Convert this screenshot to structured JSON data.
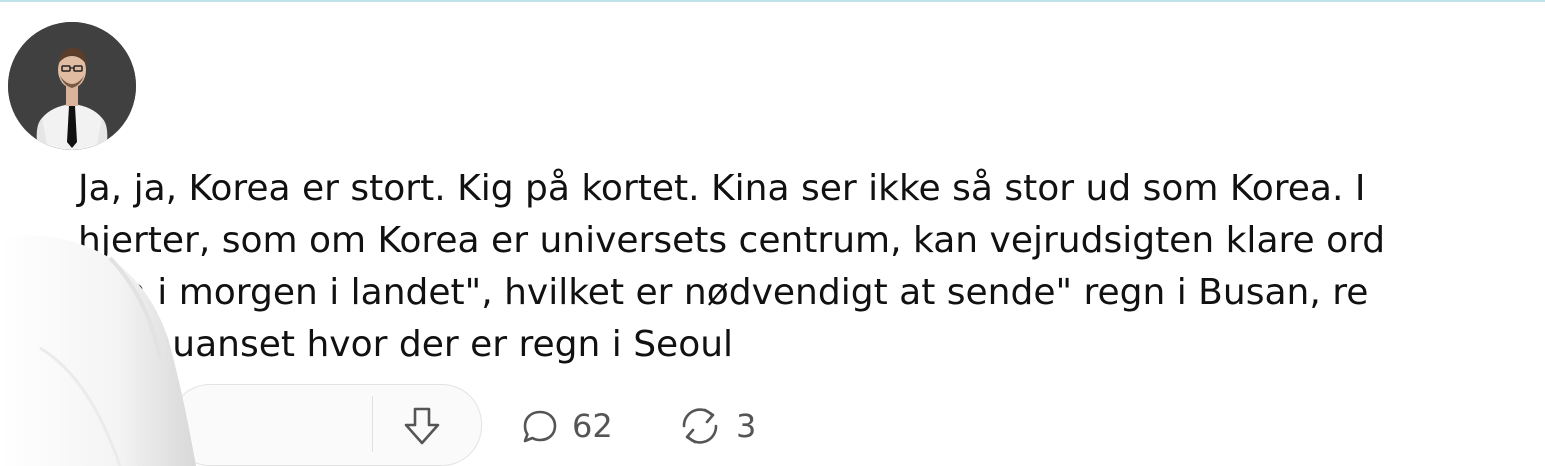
{
  "post": {
    "lines": [
      "Ja, ja, Korea er stort. Kig på kortet. Kina ser ikke så stor ud som Korea. I",
      "hjerter, som om Korea er universets centrum, kan vejrudsigten klare ord",
      "egn i morgen i landet\", hvilket er nødvendigt at sende\" regn i Busan, re",
      "oul\", uanset hvor der er regn i Seoul"
    ]
  },
  "actions": {
    "comments": {
      "icon": "comment-icon",
      "count": "62"
    },
    "reposts": {
      "icon": "repost-icon",
      "count": "3"
    },
    "downvote": {
      "icon": "downvote-icon"
    }
  },
  "colors": {
    "text": "#111111",
    "icon": "#555555",
    "pill_border": "#e3e3e3"
  }
}
